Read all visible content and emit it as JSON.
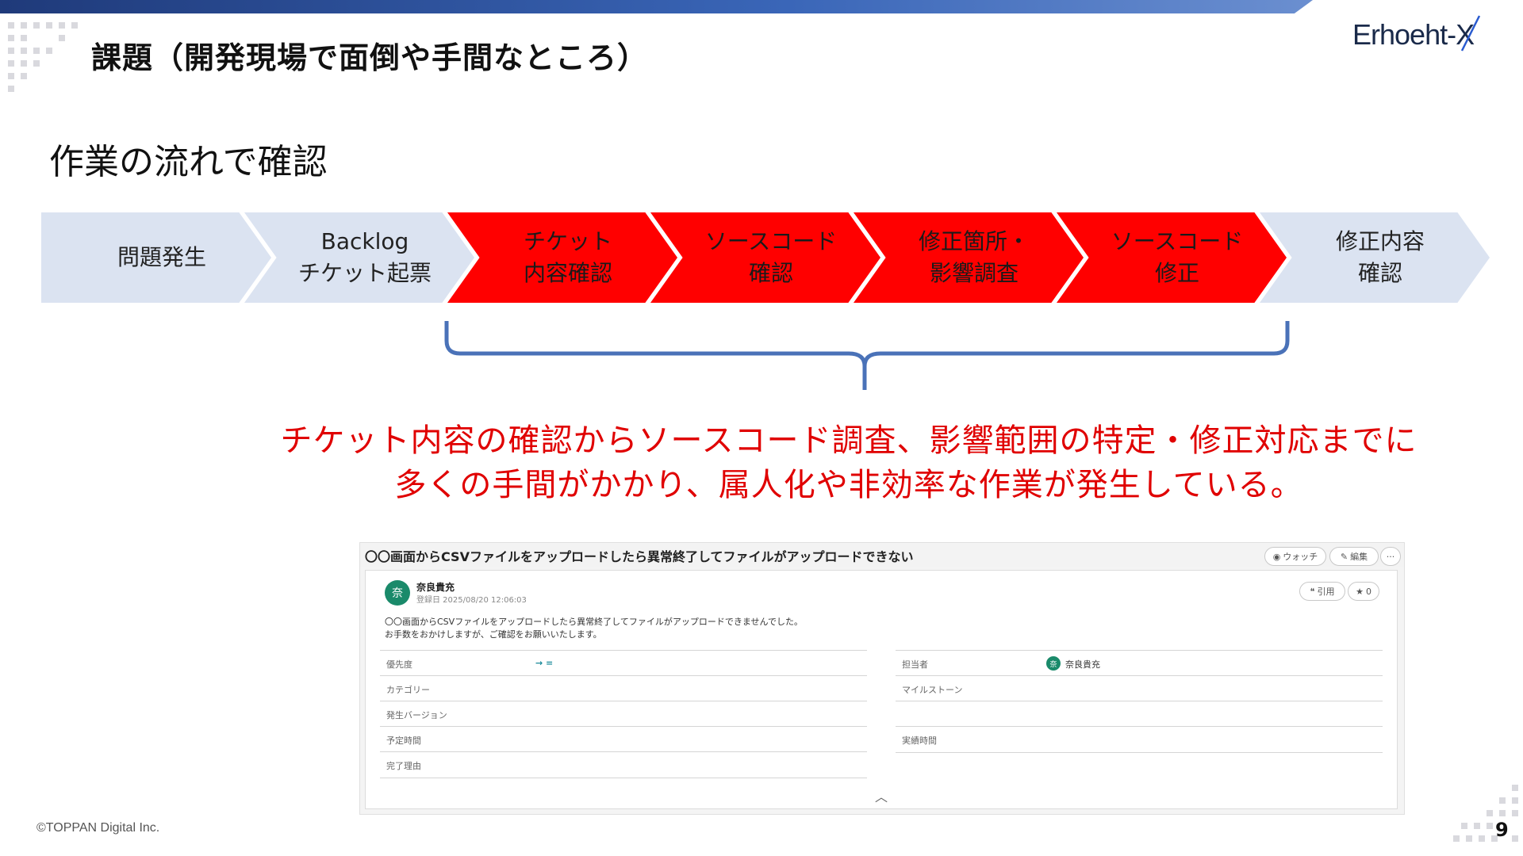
{
  "slide": {
    "title": "課題（開発現場で面倒や手間なところ）",
    "subtitle": "作業の流れで確認",
    "logo_text": "Erhoeht-X",
    "footer": "©TOPPAN Digital Inc.",
    "page_number": "9"
  },
  "flow": {
    "steps": [
      {
        "label": "問題発生",
        "highlight": false
      },
      {
        "label": "Backlog\nチケット起票",
        "highlight": false
      },
      {
        "label": "チケット\n内容確認",
        "highlight": true
      },
      {
        "label": "ソースコード\n確認",
        "highlight": true
      },
      {
        "label": "修正箇所・\n影響調査",
        "highlight": true
      },
      {
        "label": "ソースコード\n修正",
        "highlight": true
      },
      {
        "label": "修正内容\n確認",
        "highlight": false
      }
    ],
    "colors": {
      "normal": "#dbe3f1",
      "highlight": "#ff0000",
      "brace": "#4a72b8"
    }
  },
  "message": {
    "line1": "チケット内容の確認からソースコード調査、影響範囲の特定・修正対応までに",
    "line2": "多くの手間がかかり、属人化や非効率な作業が発生している。",
    "color": "#e00000"
  },
  "ticket": {
    "title": "〇〇画面からCSVファイルをアップロードしたら異常終了してファイルがアップロードできない",
    "watch_label": "ウォッチ",
    "edit_label": "編集",
    "more_label": "···",
    "quote_label": "引用",
    "star_count": "0",
    "author": "奈良貴充",
    "avatar_char": "奈",
    "date": "登録日 2025/08/20 12:06:03",
    "body_line1": "〇〇画面からCSVファイルをアップロードしたら異常終了してファイルがアップロードできませんでした。",
    "body_line2": "お手数をおかけしますが、ご確認をお願いいたします。",
    "left_fields": [
      {
        "label": "優先度",
        "value": "→ ="
      },
      {
        "label": "カテゴリー",
        "value": ""
      },
      {
        "label": "発生バージョン",
        "value": ""
      },
      {
        "label": "予定時間",
        "value": ""
      },
      {
        "label": "完了理由",
        "value": ""
      }
    ],
    "right_fields": [
      {
        "label": "担当者",
        "value": "奈良貴充"
      },
      {
        "label": "マイルストーン",
        "value": ""
      },
      {
        "label": "",
        "value": ""
      },
      {
        "label": "実績時間",
        "value": ""
      }
    ],
    "collapse_icon": "︿"
  }
}
